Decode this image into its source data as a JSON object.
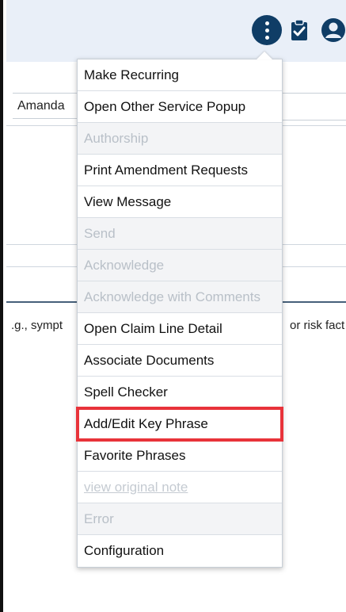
{
  "header": {
    "icons": [
      "more-vertical-icon",
      "clipboard-check-icon",
      "user-circle-icon"
    ],
    "accent_color": "#0f3d66",
    "bar_color": "#e9eff8"
  },
  "form": {
    "provider_name": "Amanda",
    "left_snippet": ".g., sympt",
    "right_snippet": "or risk fact"
  },
  "menu": {
    "items": [
      {
        "label": "Make Recurring",
        "state": "enabled"
      },
      {
        "label": "Open Other Service Popup",
        "state": "enabled"
      },
      {
        "label": "Authorship",
        "state": "disabled"
      },
      {
        "label": "Print Amendment Requests",
        "state": "enabled"
      },
      {
        "label": "View Message",
        "state": "enabled"
      },
      {
        "label": "Send",
        "state": "disabled"
      },
      {
        "label": "Acknowledge",
        "state": "disabled"
      },
      {
        "label": "Acknowledge with Comments",
        "state": "disabled"
      },
      {
        "label": "Open Claim Line Detail",
        "state": "enabled"
      },
      {
        "label": "Associate Documents",
        "state": "enabled"
      },
      {
        "label": "Spell Checker",
        "state": "enabled"
      },
      {
        "label": "Add/Edit Key Phrase",
        "state": "highlighted"
      },
      {
        "label": "Favorite Phrases",
        "state": "enabled"
      },
      {
        "label": "view original note",
        "state": "disabled-link"
      },
      {
        "label": "Error",
        "state": "disabled"
      },
      {
        "label": "Configuration",
        "state": "enabled"
      }
    ],
    "highlight_color": "#e8333a"
  }
}
